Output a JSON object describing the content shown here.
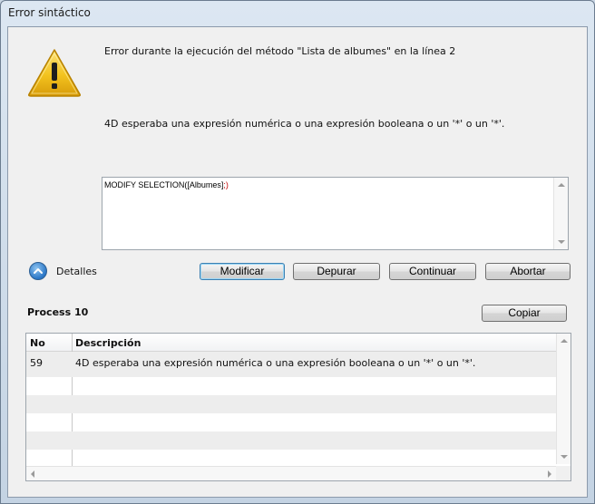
{
  "window": {
    "title": "Error sintáctico"
  },
  "message": {
    "line1": "Error durante la ejecución del método \"Lista de albumes\" en la línea 2",
    "line2": "4D esperaba una expresión numérica o una expresión booleana o un '*' o un '*'."
  },
  "code": {
    "prefix": "MODIFY SELECTION([Albumes]",
    "highlight": ";)"
  },
  "details": {
    "label": "Detalles"
  },
  "buttons": {
    "modificar": "Modificar",
    "depurar": "Depurar",
    "continuar": "Continuar",
    "abortar": "Abortar",
    "copiar": "Copiar"
  },
  "process": {
    "label": "Process 10"
  },
  "list": {
    "headers": {
      "no": "No",
      "description": "Descripción"
    },
    "rows": [
      {
        "no": "59",
        "description": "4D esperaba una expresión numérica o una expresión booleana o un '*' o un '*'."
      }
    ]
  },
  "icons": {
    "warning": "warning-icon",
    "details_toggle": "chevron-up-icon"
  },
  "colors": {
    "error_highlight": "#c00000",
    "warning_yellow": "#f3c31e"
  }
}
